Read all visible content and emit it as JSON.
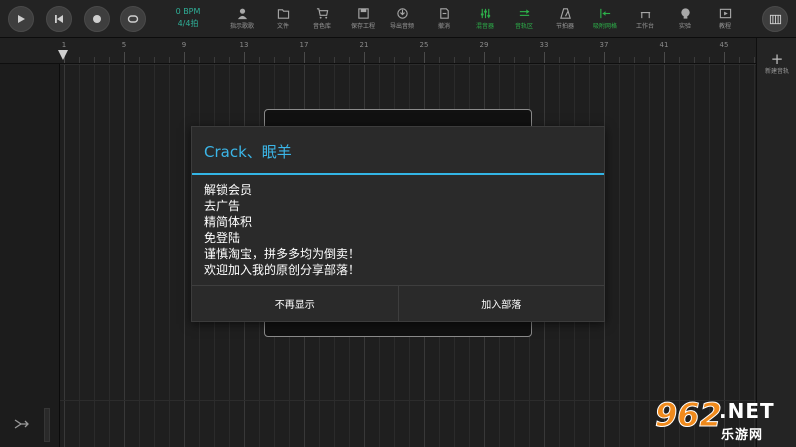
{
  "toolbar": {
    "bpm": "0 BPM",
    "time_signature": "4/4拍",
    "tools": [
      {
        "label": "指示歌歌",
        "icon": "person-icon",
        "active": false
      },
      {
        "label": "文件",
        "icon": "folder-icon",
        "active": false
      },
      {
        "label": "音色库",
        "icon": "cart-icon",
        "active": false
      },
      {
        "label": "保存工程",
        "icon": "save-icon",
        "active": false
      },
      {
        "label": "导出音频",
        "icon": "export-icon",
        "active": false
      },
      {
        "label": "撤消",
        "icon": "undo-icon",
        "active": false
      },
      {
        "label": "混音器",
        "icon": "mixer-icon",
        "active": true
      },
      {
        "label": "音轨区",
        "icon": "tracks-icon",
        "active": true
      },
      {
        "label": "节拍器",
        "icon": "metronome-icon",
        "active": false
      },
      {
        "label": "吸附网格",
        "icon": "snap-icon",
        "active": true
      },
      {
        "label": "工作台",
        "icon": "workbench-icon",
        "active": false
      },
      {
        "label": "实验",
        "icon": "lab-icon",
        "active": false
      },
      {
        "label": "教程",
        "icon": "video-icon",
        "active": false
      }
    ]
  },
  "ruler": {
    "labels": [
      "1",
      "5",
      "9",
      "13",
      "17",
      "21",
      "25",
      "29",
      "33",
      "37",
      "41",
      "45"
    ]
  },
  "right_panel": {
    "add_track_label": "新建音轨"
  },
  "dialog": {
    "title": "Crack、眠羊",
    "lines": [
      "解锁会员",
      "去广告",
      "精简体积",
      "免登陆",
      "谨慎淘宝，拼多多均为倒卖！",
      "欢迎加入我的原创分享部落！"
    ],
    "buttons": {
      "dismiss": "不再显示",
      "join": "加入部落"
    }
  },
  "watermark": {
    "brand": "962",
    "suffix": ".NET",
    "site_name": "乐游网"
  },
  "colors": {
    "accent": "#33b5e5",
    "active_tool": "#2db04a",
    "bpm": "#2fae97",
    "watermark": "#f08a1c"
  }
}
